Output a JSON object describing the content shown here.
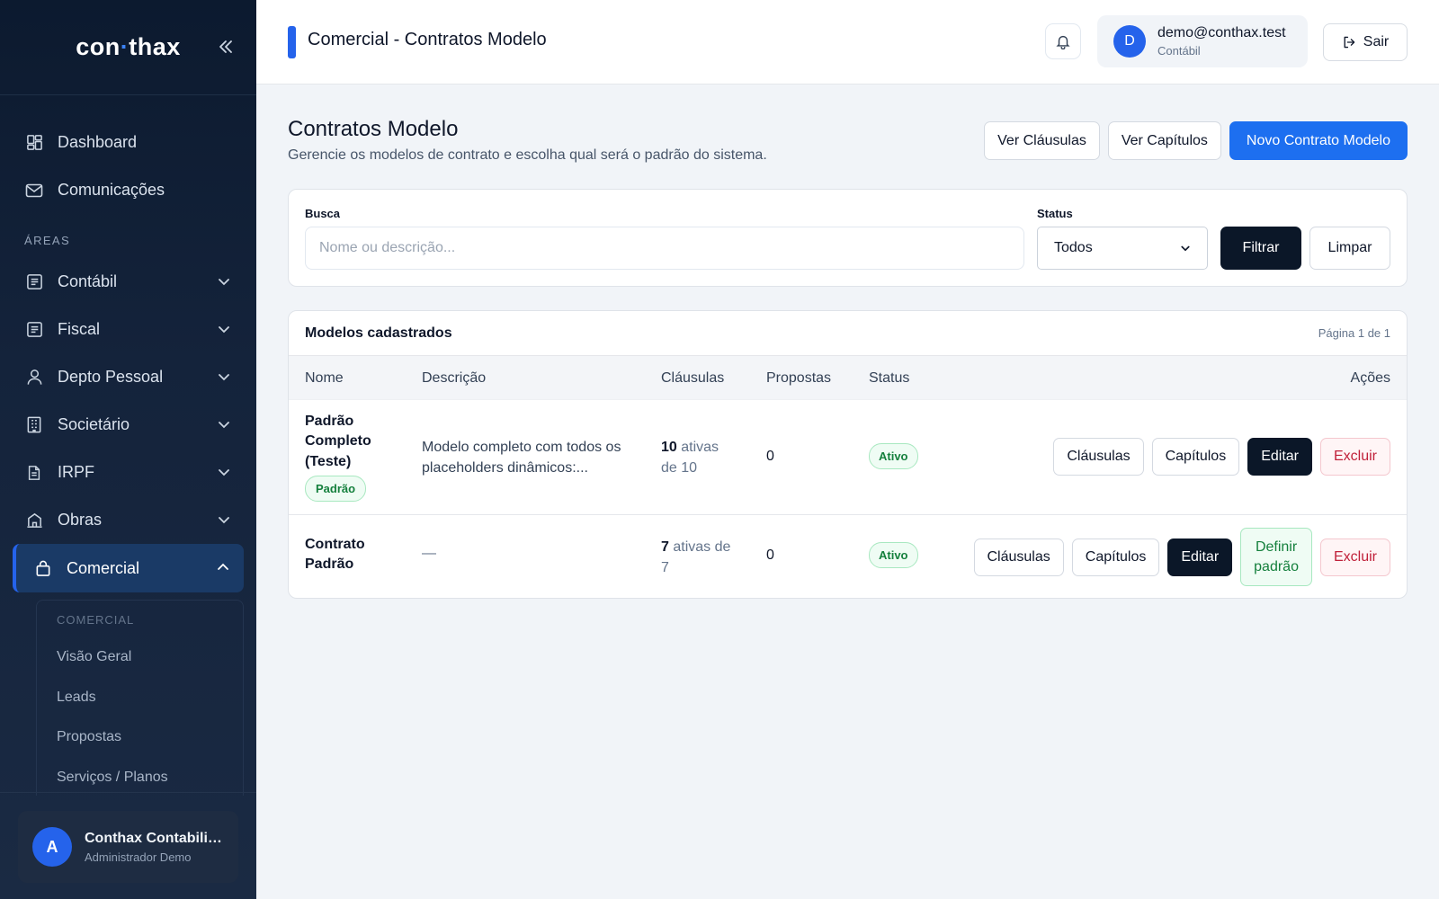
{
  "sidebar": {
    "brand": {
      "left": "con",
      "dot": "·",
      "right": "thax"
    },
    "items": [
      {
        "label": "Dashboard"
      },
      {
        "label": "Comunicações"
      }
    ],
    "section_label": "ÁREAS",
    "areas": [
      {
        "label": "Contábil"
      },
      {
        "label": "Fiscal"
      },
      {
        "label": "Depto Pessoal"
      },
      {
        "label": "Societário"
      },
      {
        "label": "IRPF"
      },
      {
        "label": "Obras"
      },
      {
        "label": "Comercial"
      }
    ],
    "submenu": {
      "label": "COMERCIAL",
      "items": [
        {
          "label": "Visão Geral"
        },
        {
          "label": "Leads"
        },
        {
          "label": "Propostas"
        },
        {
          "label": "Serviços / Planos"
        }
      ]
    },
    "user": {
      "initial": "A",
      "name": "Conthax Contabilidade",
      "role": "Administrador Demo"
    }
  },
  "topbar": {
    "title": "Comercial - Contratos Modelo",
    "account": {
      "initial": "D",
      "email": "demo@conthax.test",
      "role": "Contábil"
    },
    "logout_label": "Sair"
  },
  "page": {
    "title": "Contratos Modelo",
    "subtitle": "Gerencie os modelos de contrato e escolha qual será o padrão do sistema.",
    "actions": {
      "clauses": "Ver Cláusulas",
      "chapters": "Ver Capítulos",
      "new": "Novo Contrato Modelo"
    }
  },
  "filters": {
    "search_label": "Busca",
    "search_placeholder": "Nome ou descrição...",
    "search_value": "",
    "status_label": "Status",
    "status_value": "Todos",
    "filter_button": "Filtrar",
    "clear_button": "Limpar"
  },
  "table": {
    "title": "Modelos cadastrados",
    "pagination": "Página 1 de 1",
    "columns": {
      "name": "Nome",
      "description": "Descrição",
      "clauses": "Cláusulas",
      "proposals": "Propostas",
      "status": "Status",
      "actions": "Ações"
    },
    "rows": [
      {
        "name_l1": "Padrão",
        "name_l2": "Completo",
        "name_l3": "(Teste)",
        "default_badge": "Padrão",
        "desc_l1": "Modelo completo com todos os",
        "desc_l2": "placeholders dinâmicos:...",
        "clauses_count": "10",
        "clauses_l1": " ativas",
        "clauses_l2": "de 10",
        "proposals": "0",
        "status": "Ativo",
        "btn_clauses": "Cláusulas",
        "btn_chapters": "Capítulos",
        "btn_edit": "Editar",
        "btn_delete": "Excluir"
      },
      {
        "name_l1": "Contrato",
        "name_l2": "Padrão",
        "description": "—",
        "clauses_count": "7",
        "clauses_l1": " ativas de",
        "clauses_l2": "7",
        "proposals": "0",
        "status": "Ativo",
        "btn_clauses": "Cláusulas",
        "btn_chapters": "Capítulos",
        "btn_edit": "Editar",
        "btn_default_l1": "Definir",
        "btn_default_l2": "padrão",
        "btn_delete": "Excluir"
      }
    ]
  }
}
